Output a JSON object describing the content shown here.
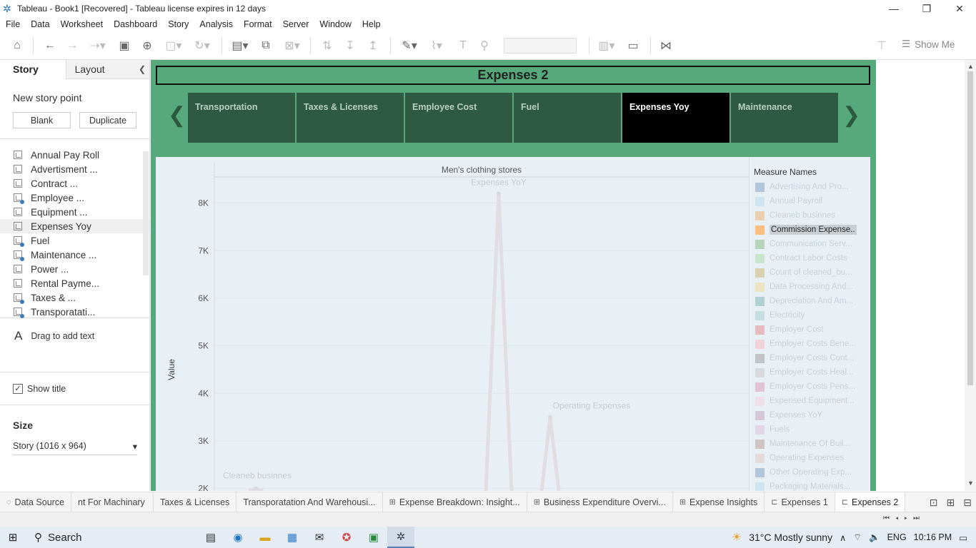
{
  "window": {
    "title": "Tableau - Book1 [Recovered] - Tableau license expires in 12 days"
  },
  "menu": [
    "File",
    "Data",
    "Worksheet",
    "Dashboard",
    "Story",
    "Analysis",
    "Format",
    "Server",
    "Window",
    "Help"
  ],
  "toolbar": {
    "show_me": "Show Me"
  },
  "left_pane": {
    "tab_story": "Story",
    "tab_layout": "Layout",
    "new_story_point": "New story point",
    "blank": "Blank",
    "duplicate": "Duplicate",
    "sheets": [
      "Annual Pay Roll",
      "Advertisment ...",
      "Contract ...",
      "Employee ...",
      "Equipment ...",
      "Expenses Yoy",
      "Fuel",
      "Maintenance ...",
      "Power ...",
      "Rental Payme...",
      "Taxes & ...",
      "Transporatati..."
    ],
    "drag_text": "Drag to add text",
    "show_title": "Show title",
    "size_label": "Size",
    "size_value": "Story (1016 x 964)"
  },
  "story": {
    "title": "Expenses 2",
    "points": [
      "Transportation",
      "Taxes & Licenses",
      "Employee Cost",
      "Fuel",
      "Expenses Yoy",
      "Maintenance"
    ],
    "active_point": "Expenses Yoy"
  },
  "chart_data": {
    "type": "line",
    "title": "Men's clothing stores",
    "ylabel": "Value",
    "yticks": [
      "2K",
      "3K",
      "4K",
      "5K",
      "6K",
      "7K",
      "8K"
    ],
    "ylim": [
      1800,
      8400
    ],
    "highlighted_series": "Commission Expense..",
    "annotations": [
      {
        "label": "Expenses YoY",
        "value": 8200
      },
      {
        "label": "Operating Expenses",
        "value": 3500
      },
      {
        "label": "Cleaneb businnes",
        "value": 2000
      }
    ]
  },
  "legend": {
    "title": "Measure Names",
    "items": [
      {
        "label": "Advertising And Pro...",
        "color": "#4e79a7"
      },
      {
        "label": "Annual Payroll",
        "color": "#a0cbe8"
      },
      {
        "label": "Cleaneb businnes",
        "color": "#f28e2b"
      },
      {
        "label": "Commission Expense..",
        "color": "#ffbe7d",
        "highlight": true
      },
      {
        "label": "Communication Serv...",
        "color": "#59a14f"
      },
      {
        "label": "Contract Labor Costs",
        "color": "#8cd17d"
      },
      {
        "label": "Count of cleaned_bu...",
        "color": "#b6992d"
      },
      {
        "label": "Data Processing And...",
        "color": "#f1ce63"
      },
      {
        "label": "Depreciation And Am...",
        "color": "#499894"
      },
      {
        "label": "Electricity",
        "color": "#86bcb6"
      },
      {
        "label": "Employer Cost",
        "color": "#e15759"
      },
      {
        "label": "Employer Costs Bene...",
        "color": "#ff9d9a"
      },
      {
        "label": "Employer Costs Cont...",
        "color": "#79706e"
      },
      {
        "label": "Employer Costs Heal...",
        "color": "#bab0ac"
      },
      {
        "label": "Employer Costs Pens...",
        "color": "#d37295"
      },
      {
        "label": "Expensed Equipment...",
        "color": "#fabfd2"
      },
      {
        "label": "Expenses YoY",
        "color": "#b07aa1"
      },
      {
        "label": "Fuels",
        "color": "#d4a6c8"
      },
      {
        "label": "Maintenance Of Buil...",
        "color": "#9d7660"
      },
      {
        "label": "Operating Expenses",
        "color": "#d7b5a6"
      },
      {
        "label": "Other Operating Exp...",
        "color": "#4e79a7"
      },
      {
        "label": "Packaging Materials...",
        "color": "#a0cbe8"
      }
    ]
  },
  "sheet_tabs": [
    "Data Source",
    "nt For Machinary",
    "Taxes & Licenses",
    "Transporatation And Warehousi...",
    "Expense Breakdown: Insight...",
    "Business Expenditure Overvi...",
    "Expense Insights",
    "Expenses 1",
    "Expenses 2"
  ],
  "taskbar": {
    "search": "Search",
    "weather": "31°C  Mostly sunny",
    "lang": "ENG",
    "time": "10:16 PM"
  }
}
